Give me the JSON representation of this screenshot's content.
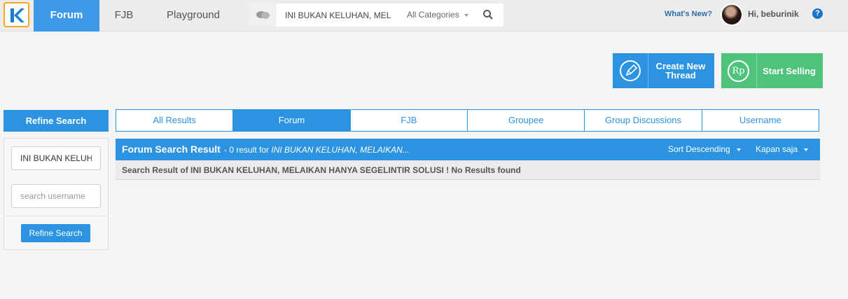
{
  "nav": {
    "tabs": [
      "Forum",
      "FJB",
      "Playground"
    ],
    "search": {
      "value": "INI BUKAN KELUHAN, MEL",
      "category": "All Categories"
    },
    "whats_new": "What's New?",
    "greeting": "Hi, beburinik",
    "help": "?"
  },
  "actions": {
    "create_thread": "Create New Thread",
    "start_selling": "Start Selling",
    "sell_icon_text": "Rp"
  },
  "refine": {
    "title": "Refine Search",
    "query_value": "INI BUKAN KELUHAN",
    "username_placeholder": "search username",
    "button": "Refine Search"
  },
  "result_tabs": [
    {
      "label": "All Results",
      "active": false
    },
    {
      "label": "Forum",
      "active": true
    },
    {
      "label": "FJB",
      "active": false
    },
    {
      "label": "Groupee",
      "active": false
    },
    {
      "label": "Group Discussions",
      "active": false
    },
    {
      "label": "Username",
      "active": false
    }
  ],
  "results": {
    "title": "Forum Search Result",
    "count_text": "- 0 result for",
    "query_snippet": "INI BUKAN KELUHAN, MELAIKAN...",
    "sort": "Sort Descending",
    "time": "Kapan saja",
    "message": "Search Result of INI BUKAN KELUHAN, MELAIKAN HANYA SEGELINTIR SOLUSI ! No Results found"
  },
  "colors": {
    "primary": "#2b93e0",
    "success": "#4fc27c",
    "logo_border": "#f5a623"
  }
}
